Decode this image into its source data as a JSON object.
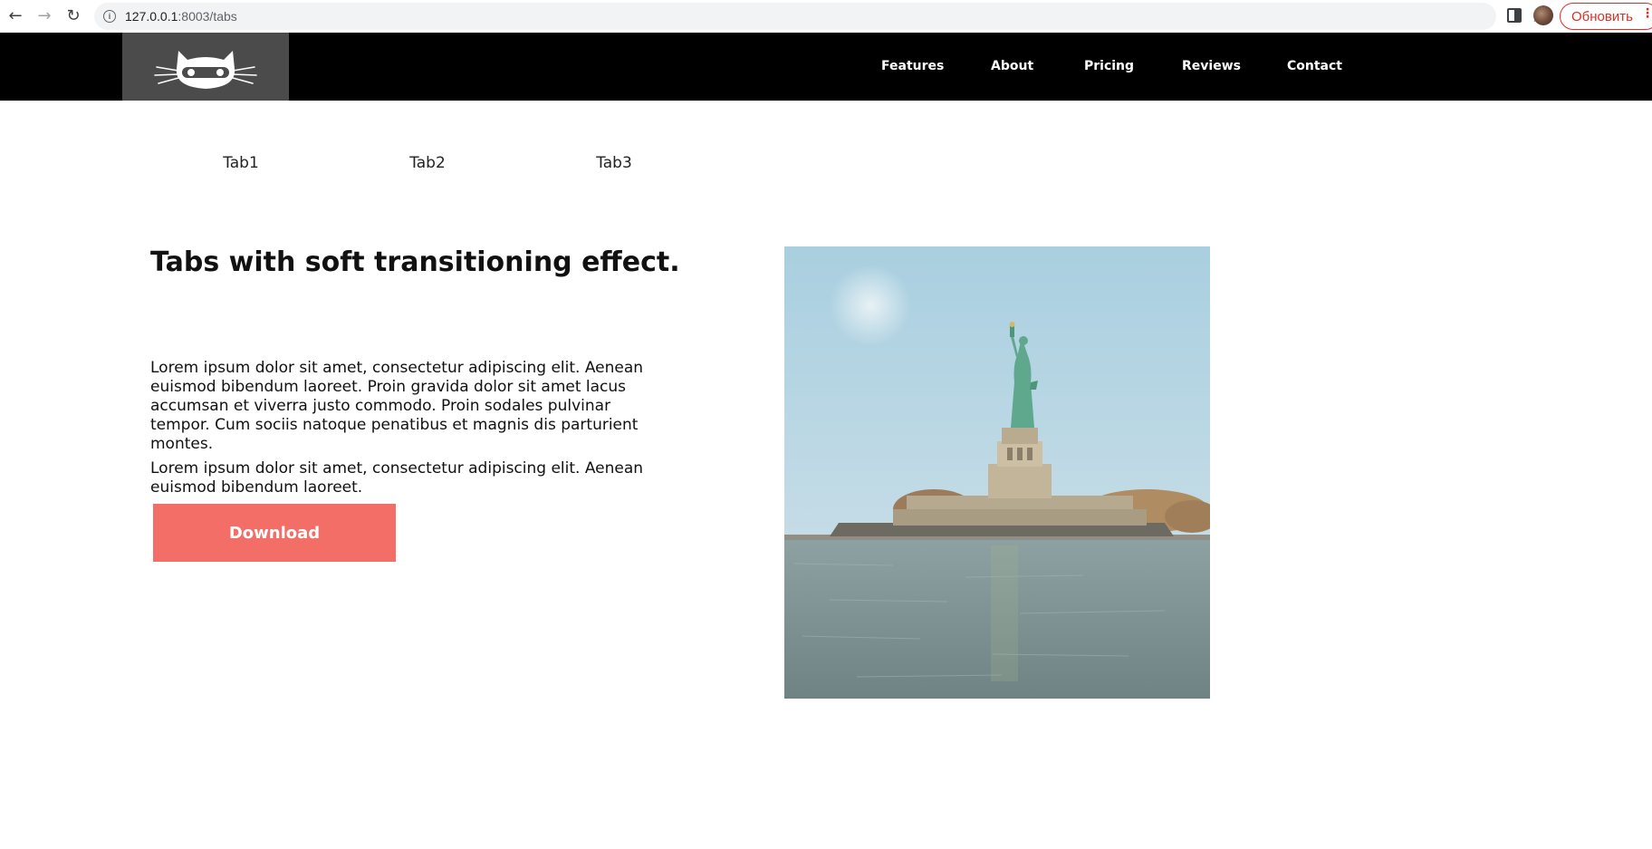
{
  "browser": {
    "url_host": "127.0.0.1",
    "url_path": ":8003/tabs",
    "update_label": "Обновить",
    "icons": [
      "back-icon",
      "forward-icon",
      "reload-icon",
      "info-icon",
      "send-icon",
      "star-icon",
      "sidepanel-icon",
      "avatar",
      "menu-dots-icon"
    ]
  },
  "header": {
    "logo_icon": "cat-logo-icon",
    "nav": {
      "features": "Features",
      "about": "About",
      "pricing": "Pricing",
      "reviews": "Reviews",
      "contact": "Contact"
    }
  },
  "tabs": {
    "tab1": "Tab1",
    "tab2": "Tab2",
    "tab3": "Tab3"
  },
  "content": {
    "title": "Tabs with soft transitioning effect.",
    "paragraph1": "Lorem ipsum dolor sit amet, consectetur adipiscing elit. Aenean euismod bibendum laoreet. Proin gravida dolor sit amet lacus accumsan et viverra justo commodo. Proin sodales pulvinar tempor. Cum sociis natoque penatibus et magnis dis parturient montes.",
    "paragraph2": "Lorem ipsum dolor sit amet, consectetur adipiscing elit. Aenean euismod bibendum laoreet.",
    "download_label": "Download"
  },
  "colors": {
    "header_bg": "#000000",
    "logo_bg": "#4b4b4b",
    "button_bg": "#f26e67",
    "update_red": "#d93025"
  }
}
